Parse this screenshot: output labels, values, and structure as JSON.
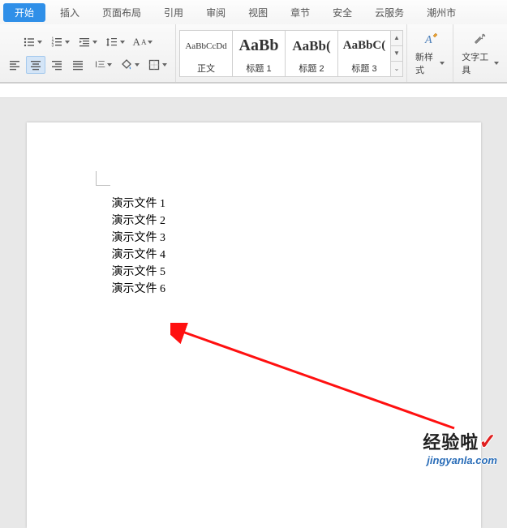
{
  "tabs": {
    "start": "开始",
    "insert": "插入",
    "layout": "页面布局",
    "reference": "引用",
    "review": "审阅",
    "view": "视图",
    "chapter": "章节",
    "security": "安全",
    "cloud": "云服务",
    "extra": "潮州市"
  },
  "styles": {
    "normal": {
      "preview": "AaBbCcDd",
      "label": "正文"
    },
    "h1": {
      "preview": "AaBb",
      "label": "标题 1"
    },
    "h2": {
      "preview": "AaBb(",
      "label": "标题 2"
    },
    "h3": {
      "preview": "AaBbC(",
      "label": "标题 3"
    }
  },
  "buttons": {
    "newStyle": "新样式",
    "textTool": "文字工具"
  },
  "document": {
    "lines": [
      "演示文件 1",
      "演示文件 2",
      "演示文件 3",
      "演示文件 4",
      "演示文件 5",
      "演示文件 6"
    ]
  },
  "watermark": {
    "brand": "经验啦",
    "url": "jingyanla.com"
  }
}
